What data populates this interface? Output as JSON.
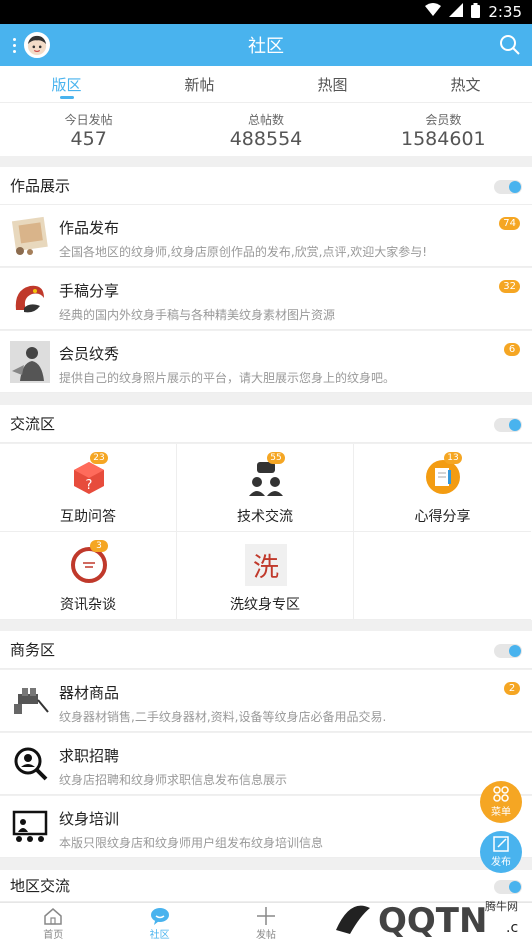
{
  "status": {
    "time": "2:35"
  },
  "header": {
    "title": "社区"
  },
  "tabs": [
    {
      "label": "版区"
    },
    {
      "label": "新帖"
    },
    {
      "label": "热图"
    },
    {
      "label": "热文"
    }
  ],
  "stats": [
    {
      "label": "今日发帖",
      "value": "457"
    },
    {
      "label": "总帖数",
      "value": "488554"
    },
    {
      "label": "会员数",
      "value": "1584601"
    }
  ],
  "sections": {
    "works": {
      "title": "作品展示",
      "items": [
        {
          "name": "作品发布",
          "desc": "全国各地区的纹身师,纹身店原创作品的发布,欣赏,点评,欢迎大家参与!",
          "badge": "74"
        },
        {
          "name": "手稿分享",
          "desc": "经典的国内外纹身手稿与各种精美纹身素材图片资源",
          "badge": "32"
        },
        {
          "name": "会员纹秀",
          "desc": "提供自己的纹身照片展示的平台，请大胆展示您身上的纹身吧。",
          "badge": "6"
        }
      ]
    },
    "exchange": {
      "title": "交流区",
      "items": [
        {
          "name": "互助问答",
          "badge": "23"
        },
        {
          "name": "技术交流",
          "badge": "55"
        },
        {
          "name": "心得分享",
          "badge": "13"
        },
        {
          "name": "资讯杂谈",
          "badge": "3"
        },
        {
          "name": "洗纹身专区",
          "icon_text": "洗"
        }
      ]
    },
    "business": {
      "title": "商务区",
      "items": [
        {
          "name": "器材商品",
          "desc": "纹身器材销售,二手纹身器材,资料,设备等纹身店必备用品交易.",
          "badge": "2"
        },
        {
          "name": "求职招聘",
          "desc": "纹身店招聘和纹身师求职信息发布信息展示"
        },
        {
          "name": "纹身培训",
          "desc": "本版只限纹身店和纹身师用户组发布纹身培训信息"
        }
      ]
    },
    "region": {
      "title": "地区交流"
    }
  },
  "fab": {
    "menu": "菜单",
    "post": "发布"
  },
  "bottom_nav": [
    {
      "label": "首页"
    },
    {
      "label": "社区"
    },
    {
      "label": "发帖"
    }
  ],
  "watermark": {
    "text": "腾牛网"
  },
  "colors": {
    "accent": "#49b3ee",
    "badge": "#f5a623"
  }
}
